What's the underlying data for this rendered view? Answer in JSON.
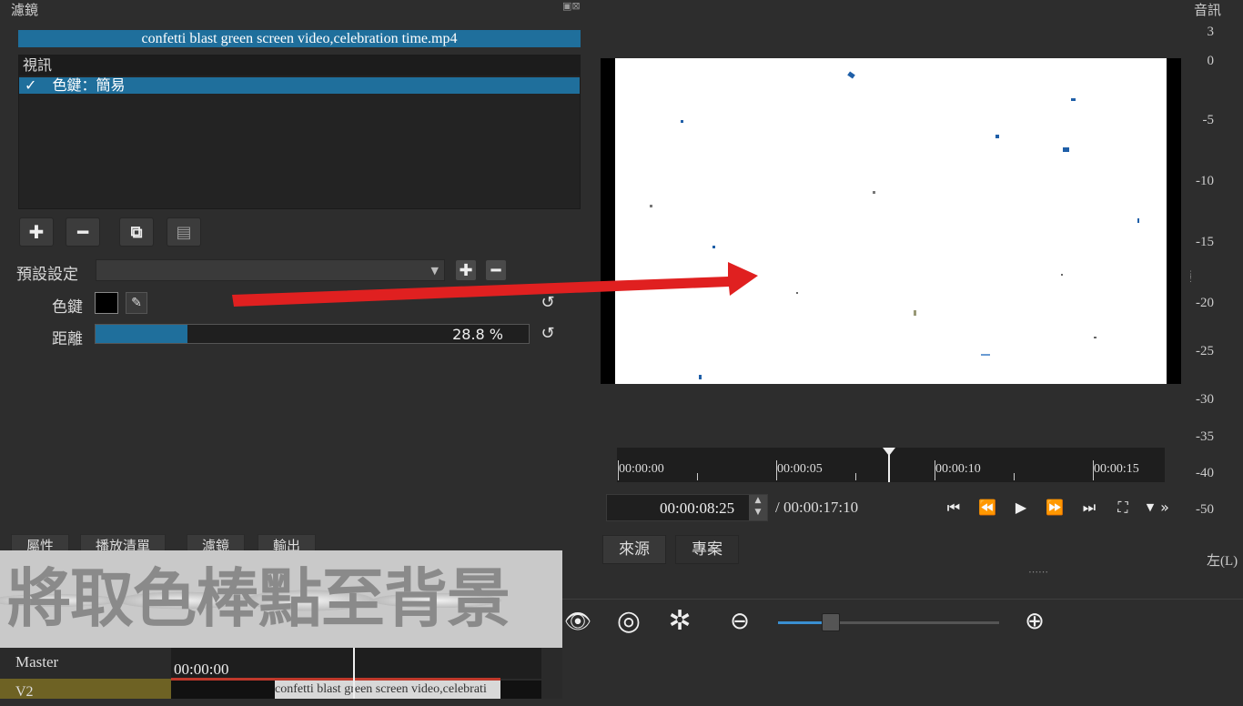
{
  "filters_panel": {
    "title": "濾鏡",
    "clip_name": "confetti blast green screen video,celebration time.mp4",
    "category": "視訊",
    "filter_item": "色鍵：簡易",
    "check_mark": "✓",
    "buttons": {
      "add": "✚",
      "remove": "━",
      "copy": "⧉",
      "paste": "▤"
    },
    "preset_label": "預設設定",
    "preset_value": "",
    "key_label": "色鍵",
    "key_color": "#000000",
    "distance_label": "距離",
    "distance_value": "28.8 %",
    "distance_fraction": 0.288,
    "reset_glyph": "↺"
  },
  "left_tabs": [
    "屬性",
    "播放清單",
    "濾鏡",
    "輸出"
  ],
  "caption": "將取色棒點至背景",
  "timeline": {
    "master_label": "Master",
    "ruler_time": "00:00:00",
    "track_label": "V2",
    "clip_label": "confetti blast green screen video,celebrati"
  },
  "viewer": {
    "scrubber_labels": [
      "00:00:00",
      "00:00:05",
      "00:00:10",
      "00:00:15"
    ],
    "current_time": "00:00:08:25",
    "duration": "/ 00:00:17:10",
    "source_tab": "來源",
    "project_tab": "專案",
    "more_glyph": "»"
  },
  "meter": {
    "title": "音訊",
    "labels": [
      "3",
      "0",
      "-5",
      "-10",
      "-15",
      "-20",
      "-25",
      "-30",
      "-35",
      "-40",
      "-50"
    ],
    "channel": "左(L)"
  },
  "colors": {
    "accent": "#1f6f9c",
    "arrow": "#e02020"
  }
}
